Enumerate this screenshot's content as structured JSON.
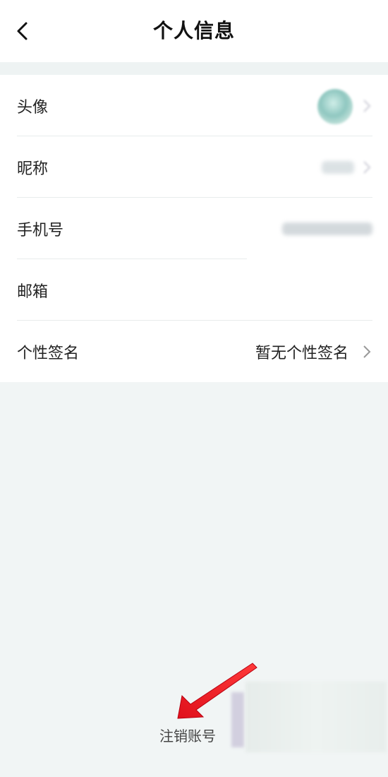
{
  "header": {
    "title": "个人信息",
    "back_icon": "chevron-left-icon"
  },
  "rows": [
    {
      "label": "头像",
      "value": "",
      "kind": "avatar",
      "icon": "chevron-right-icon"
    },
    {
      "label": "昵称",
      "value": "",
      "kind": "blurred",
      "icon": "chevron-right-icon"
    },
    {
      "label": "手机号",
      "value": "",
      "kind": "blurred",
      "icon": ""
    },
    {
      "label": "邮箱",
      "value": "",
      "kind": "empty",
      "icon": ""
    },
    {
      "label": "个性签名",
      "value": "暂无个性签名",
      "kind": "text",
      "icon": "chevron-right-icon"
    }
  ],
  "footer": {
    "cancel_account_label": "注销账号"
  },
  "annotation": {
    "arrow_color": "#e0101c"
  }
}
